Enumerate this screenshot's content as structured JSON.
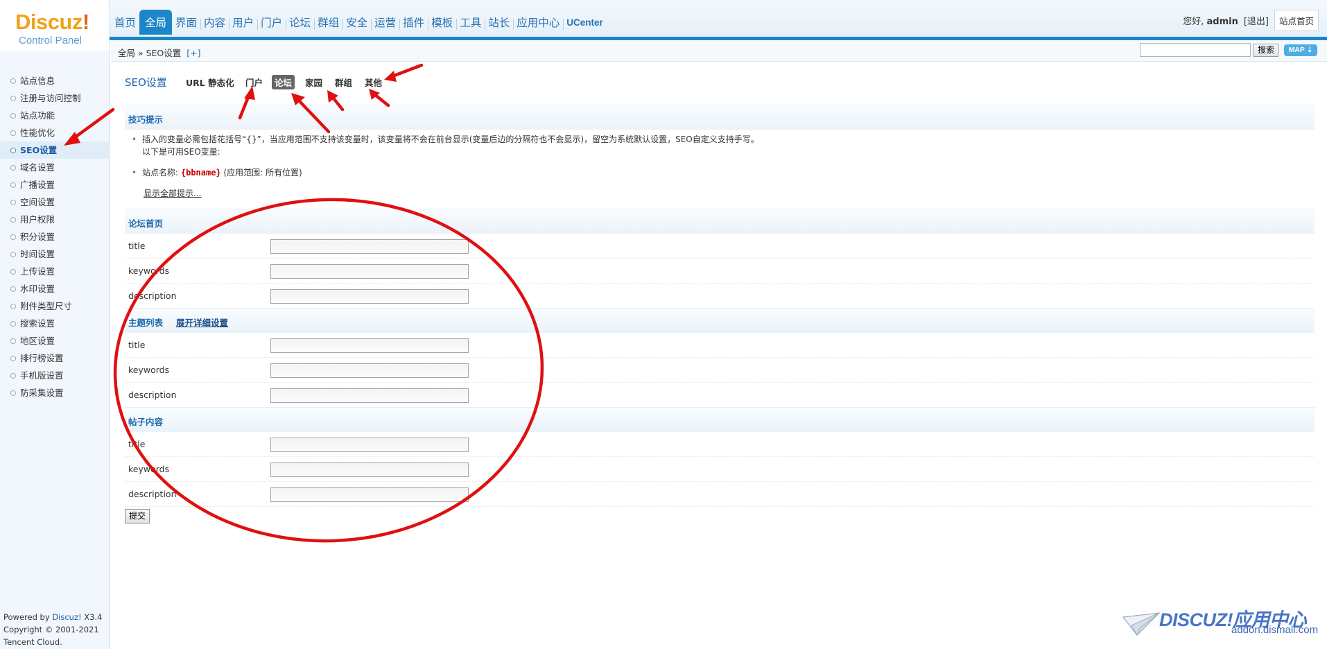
{
  "logo": {
    "brand": "Discuz",
    "brand_mark": "!",
    "subtitle": "Control Panel"
  },
  "topnav": {
    "items": [
      "首页",
      "全局",
      "界面",
      "内容",
      "用户",
      "门户",
      "论坛",
      "群组",
      "安全",
      "运营",
      "插件",
      "模板",
      "工具",
      "站长",
      "应用中心",
      "UCenter"
    ],
    "active": "全局"
  },
  "userbar": {
    "greeting": "您好,",
    "username": "admin",
    "logout": "[退出]",
    "home": "站点首页"
  },
  "breadcrumb": {
    "path": "全局 » SEO设置",
    "add": "[+]"
  },
  "search": {
    "button": "搜索",
    "map": "MAP ⇣",
    "value": ""
  },
  "sidebar": {
    "items": [
      "站点信息",
      "注册与访问控制",
      "站点功能",
      "性能优化",
      "SEO设置",
      "域名设置",
      "广播设置",
      "空间设置",
      "用户权限",
      "积分设置",
      "时间设置",
      "上传设置",
      "水印设置",
      "附件类型尺寸",
      "搜索设置",
      "地区设置",
      "排行榜设置",
      "手机版设置",
      "防采集设置"
    ],
    "active_index": 4,
    "footer": {
      "powered_prefix": "Powered by ",
      "powered_brand": "Discuz!",
      "powered_version": " X3.4",
      "copyright": "Copyright © 2001-2021",
      "company": "Tencent Cloud."
    }
  },
  "page": {
    "title": "SEO设置",
    "tabs": [
      "URL 静态化",
      "门户",
      "论坛",
      "家园",
      "群组",
      "其他"
    ],
    "current_tab": "论坛"
  },
  "tips": {
    "header": "技巧提示",
    "line1": "插入的变量必需包括花括号“{}”，当应用范围不支持该变量时，该变量将不会在前台显示(变量后边的分隔符也不会显示)，留空为系统默认设置，SEO自定义支持手写。",
    "line1b": "以下是可用SEO变量:",
    "var_prefix": "站点名称:",
    "var_name": "{bbname}",
    "var_scope": "(应用范围: 所有位置)",
    "show_all": "显示全部提示..."
  },
  "sections": [
    {
      "title": "论坛首页",
      "fields": [
        {
          "label": "title",
          "value": ""
        },
        {
          "label": "keywords",
          "value": ""
        },
        {
          "label": "description",
          "value": ""
        }
      ]
    },
    {
      "title": "主题列表",
      "expand": "展开详细设置",
      "fields": [
        {
          "label": "title",
          "value": ""
        },
        {
          "label": "keywords",
          "value": ""
        },
        {
          "label": "description",
          "value": ""
        }
      ]
    },
    {
      "title": "帖子内容",
      "fields": [
        {
          "label": "title",
          "value": ""
        },
        {
          "label": "keywords",
          "value": ""
        },
        {
          "label": "description",
          "value": ""
        }
      ]
    }
  ],
  "submit": "提交",
  "watermark": {
    "title": "DISCUZ!应用中心",
    "url": "addon.dismall.com"
  },
  "colors": {
    "accent": "#1c86c8",
    "annotation": "#e01010",
    "tab_current": "#666666"
  }
}
